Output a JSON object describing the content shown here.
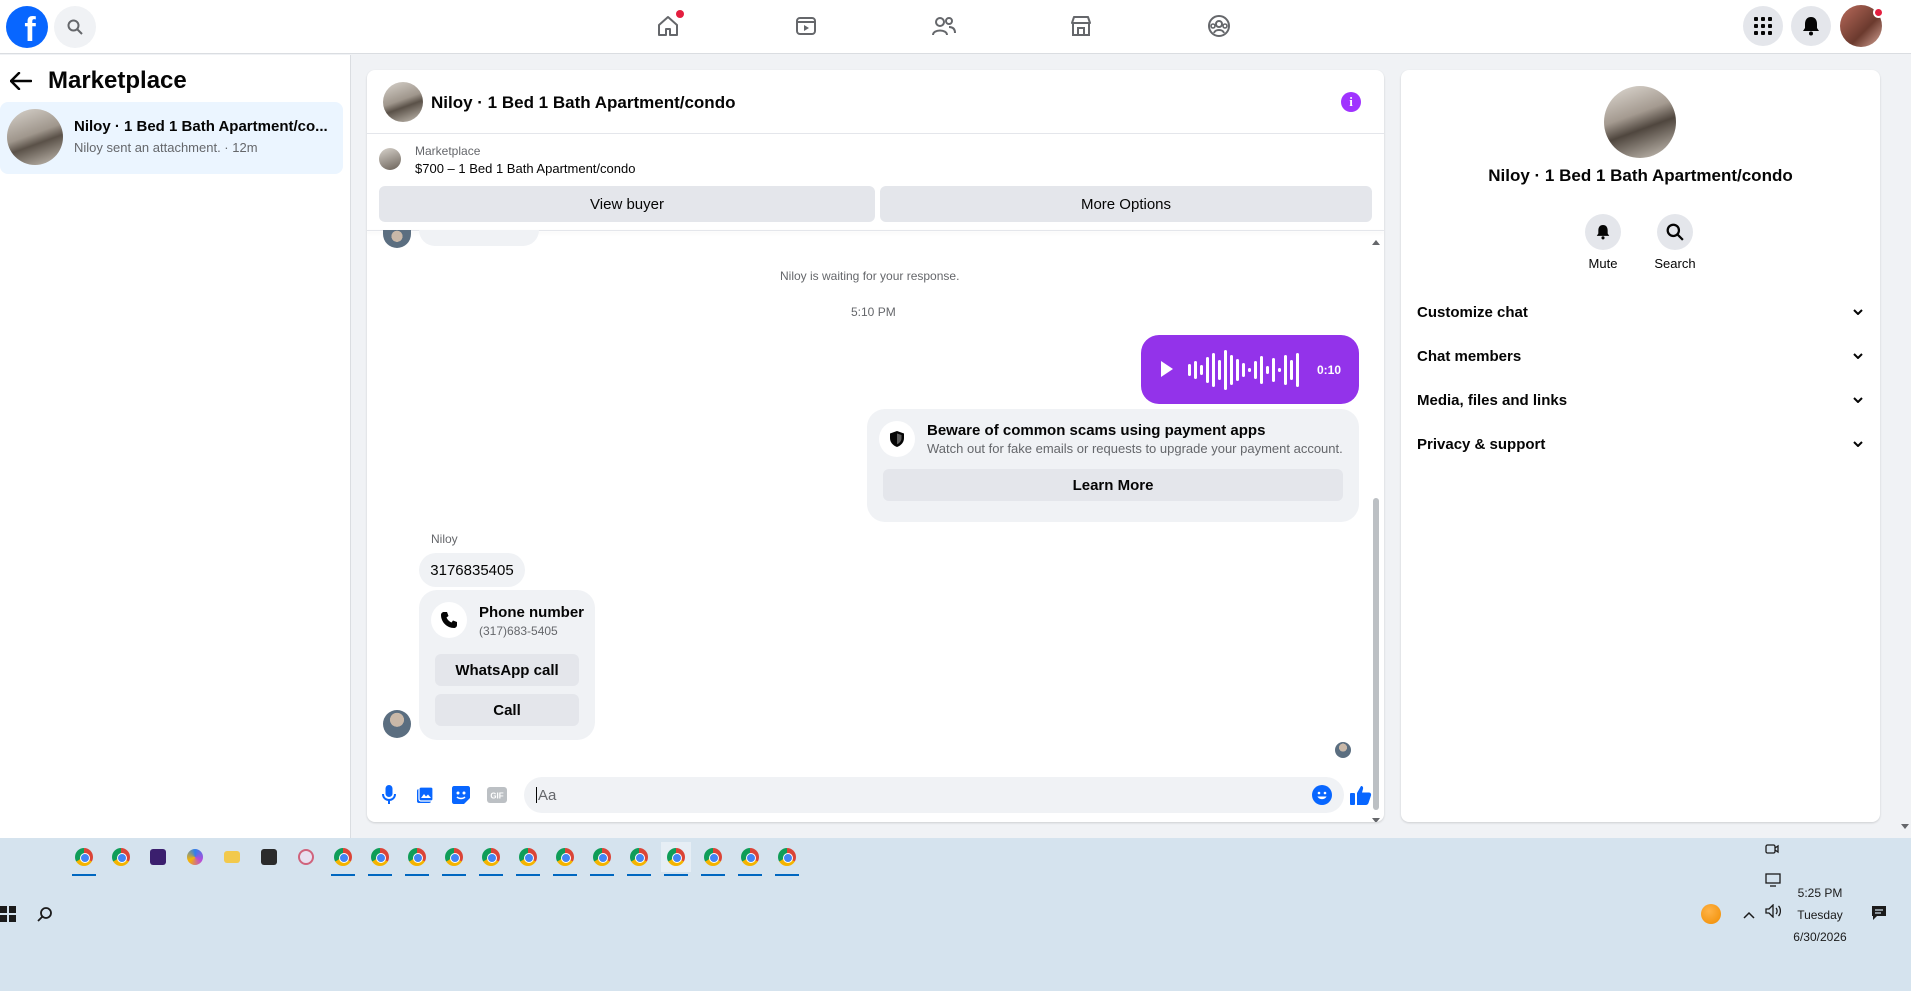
{
  "nav": {
    "logo_letter": "f",
    "tabs": [
      "home-icon",
      "video-icon",
      "friends-icon",
      "marketplace-icon",
      "groups-icon"
    ],
    "right": [
      "menu-grid-icon",
      "notifications-icon",
      "profile-avatar"
    ]
  },
  "left": {
    "title": "Marketplace",
    "conversation": {
      "title": "Niloy · 1 Bed 1 Bath Apartment/co...",
      "subtitle": "Niloy sent an attachment. · 12m"
    }
  },
  "chat": {
    "title": "Niloy · 1 Bed 1 Bath Apartment/condo",
    "marketplace_label": "Marketplace",
    "listing": "$700 – 1 Bed 1 Bath Apartment/condo",
    "view_buyer": "View buyer",
    "more_options": "More Options",
    "waiting": "Niloy is waiting for your response.",
    "time": "5:10 PM",
    "voice_duration": "0:10",
    "scam_title": "Beware of common scams using payment apps",
    "scam_desc": "Watch out for fake emails or requests to upgrade your payment account.",
    "learn_more": "Learn More",
    "sender": "Niloy",
    "phone_message": "3176835405",
    "phone_card_title": "Phone number",
    "phone_card_number": "(317)683-5405",
    "whatsapp_call": "WhatsApp call",
    "call": "Call",
    "composer_placeholder": "Aa",
    "accent": "#9333ea"
  },
  "right": {
    "title": "Niloy · 1 Bed 1 Bath Apartment/condo",
    "mute": "Mute",
    "search": "Search",
    "sections": [
      "Customize chat",
      "Chat members",
      "Media, files and links",
      "Privacy & support"
    ]
  },
  "taskbar": {
    "time": "5:25 PM",
    "day": "Tuesday",
    "date": "6/30/2026"
  }
}
